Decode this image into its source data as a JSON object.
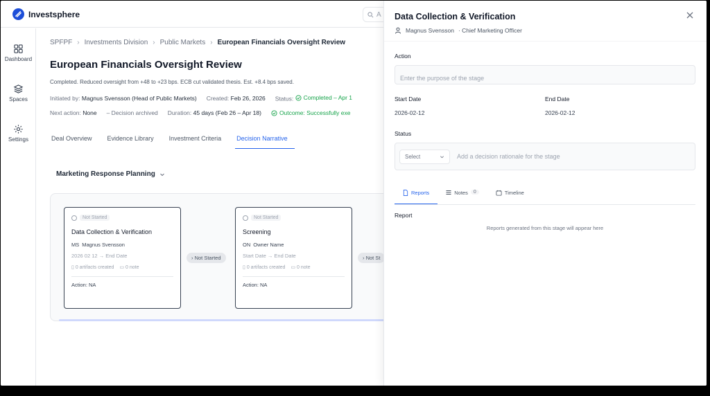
{
  "app": {
    "name": "Investsphere",
    "search_placeholder": "A"
  },
  "nav": [
    {
      "label": "Dashboard",
      "icon": "dashboard-icon"
    },
    {
      "label": "Spaces",
      "icon": "layers-icon"
    },
    {
      "label": "Settings",
      "icon": "gear-icon"
    }
  ],
  "breadcrumb": [
    "SPFPF",
    "Investments Division",
    "Public Markets",
    "European Financials Oversight Review"
  ],
  "page": {
    "title": "European Financials Oversight Review",
    "summary": "Completed. Reduced oversight from +48 to +23 bps. ECB cut validated thesis. Est. +8.4 bps saved.",
    "initiated_label": "Initiated by:",
    "initiated_value": "Magnus Svensson (Head of Public Markets)",
    "created_label": "Created:",
    "created_value": "Feb 26, 2026",
    "status_label": "Status:",
    "status_value": "Completed – Apr 1",
    "next_label": "Next action:",
    "next_value": "None",
    "decision": "– Decision archived",
    "duration_label": "Duration:",
    "duration_value": "45 days (Feb 26 – Apr 18)",
    "outcome": "Outcome: Successfully exe"
  },
  "tabs": [
    "Deal Overview",
    "Evidence Library",
    "Investment Criteria",
    "Decision Narrative"
  ],
  "stage_group": "Marketing Response Planning",
  "cards": [
    {
      "status": "Not Started",
      "title": "Data Collection & Verification",
      "initials": "MS",
      "owner": "Magnus Svensson",
      "dates": "2026  02  12  → End Date",
      "artifacts": "0 artifacts created",
      "notes": "0 note",
      "action": "Action: NA"
    },
    {
      "status": "Not Started",
      "title": "Screening",
      "initials": "ON",
      "owner": "Owner Name",
      "dates": "Start Date  → End Date",
      "artifacts": "0 artifacts created",
      "notes": "0 note",
      "action": "Action: NA"
    }
  ],
  "connectors": [
    "Not Started",
    "Not St"
  ],
  "panel": {
    "title": "Data Collection & Verification",
    "owner": "Magnus Svensson",
    "role": "· Chief Marketing Officer",
    "action_label": "Action",
    "action_placeholder": "Enter the purpose of the stage",
    "start_label": "Start Date",
    "start_value": "2026-02-12",
    "end_label": "End Date",
    "end_value": "2026-02-12",
    "status_label": "Status",
    "status_select": "Select",
    "rationale_placeholder": "Add a decision rationale for the stage",
    "tabs": [
      {
        "label": "Reports"
      },
      {
        "label": "Notes",
        "count": "0"
      },
      {
        "label": "Timeline"
      }
    ],
    "report_label": "Report",
    "report_empty": "Reports generated from this stage will appear here"
  },
  "colors": {
    "accent": "#2563eb",
    "success": "#16a34a",
    "brand": "#1d4ed8"
  }
}
